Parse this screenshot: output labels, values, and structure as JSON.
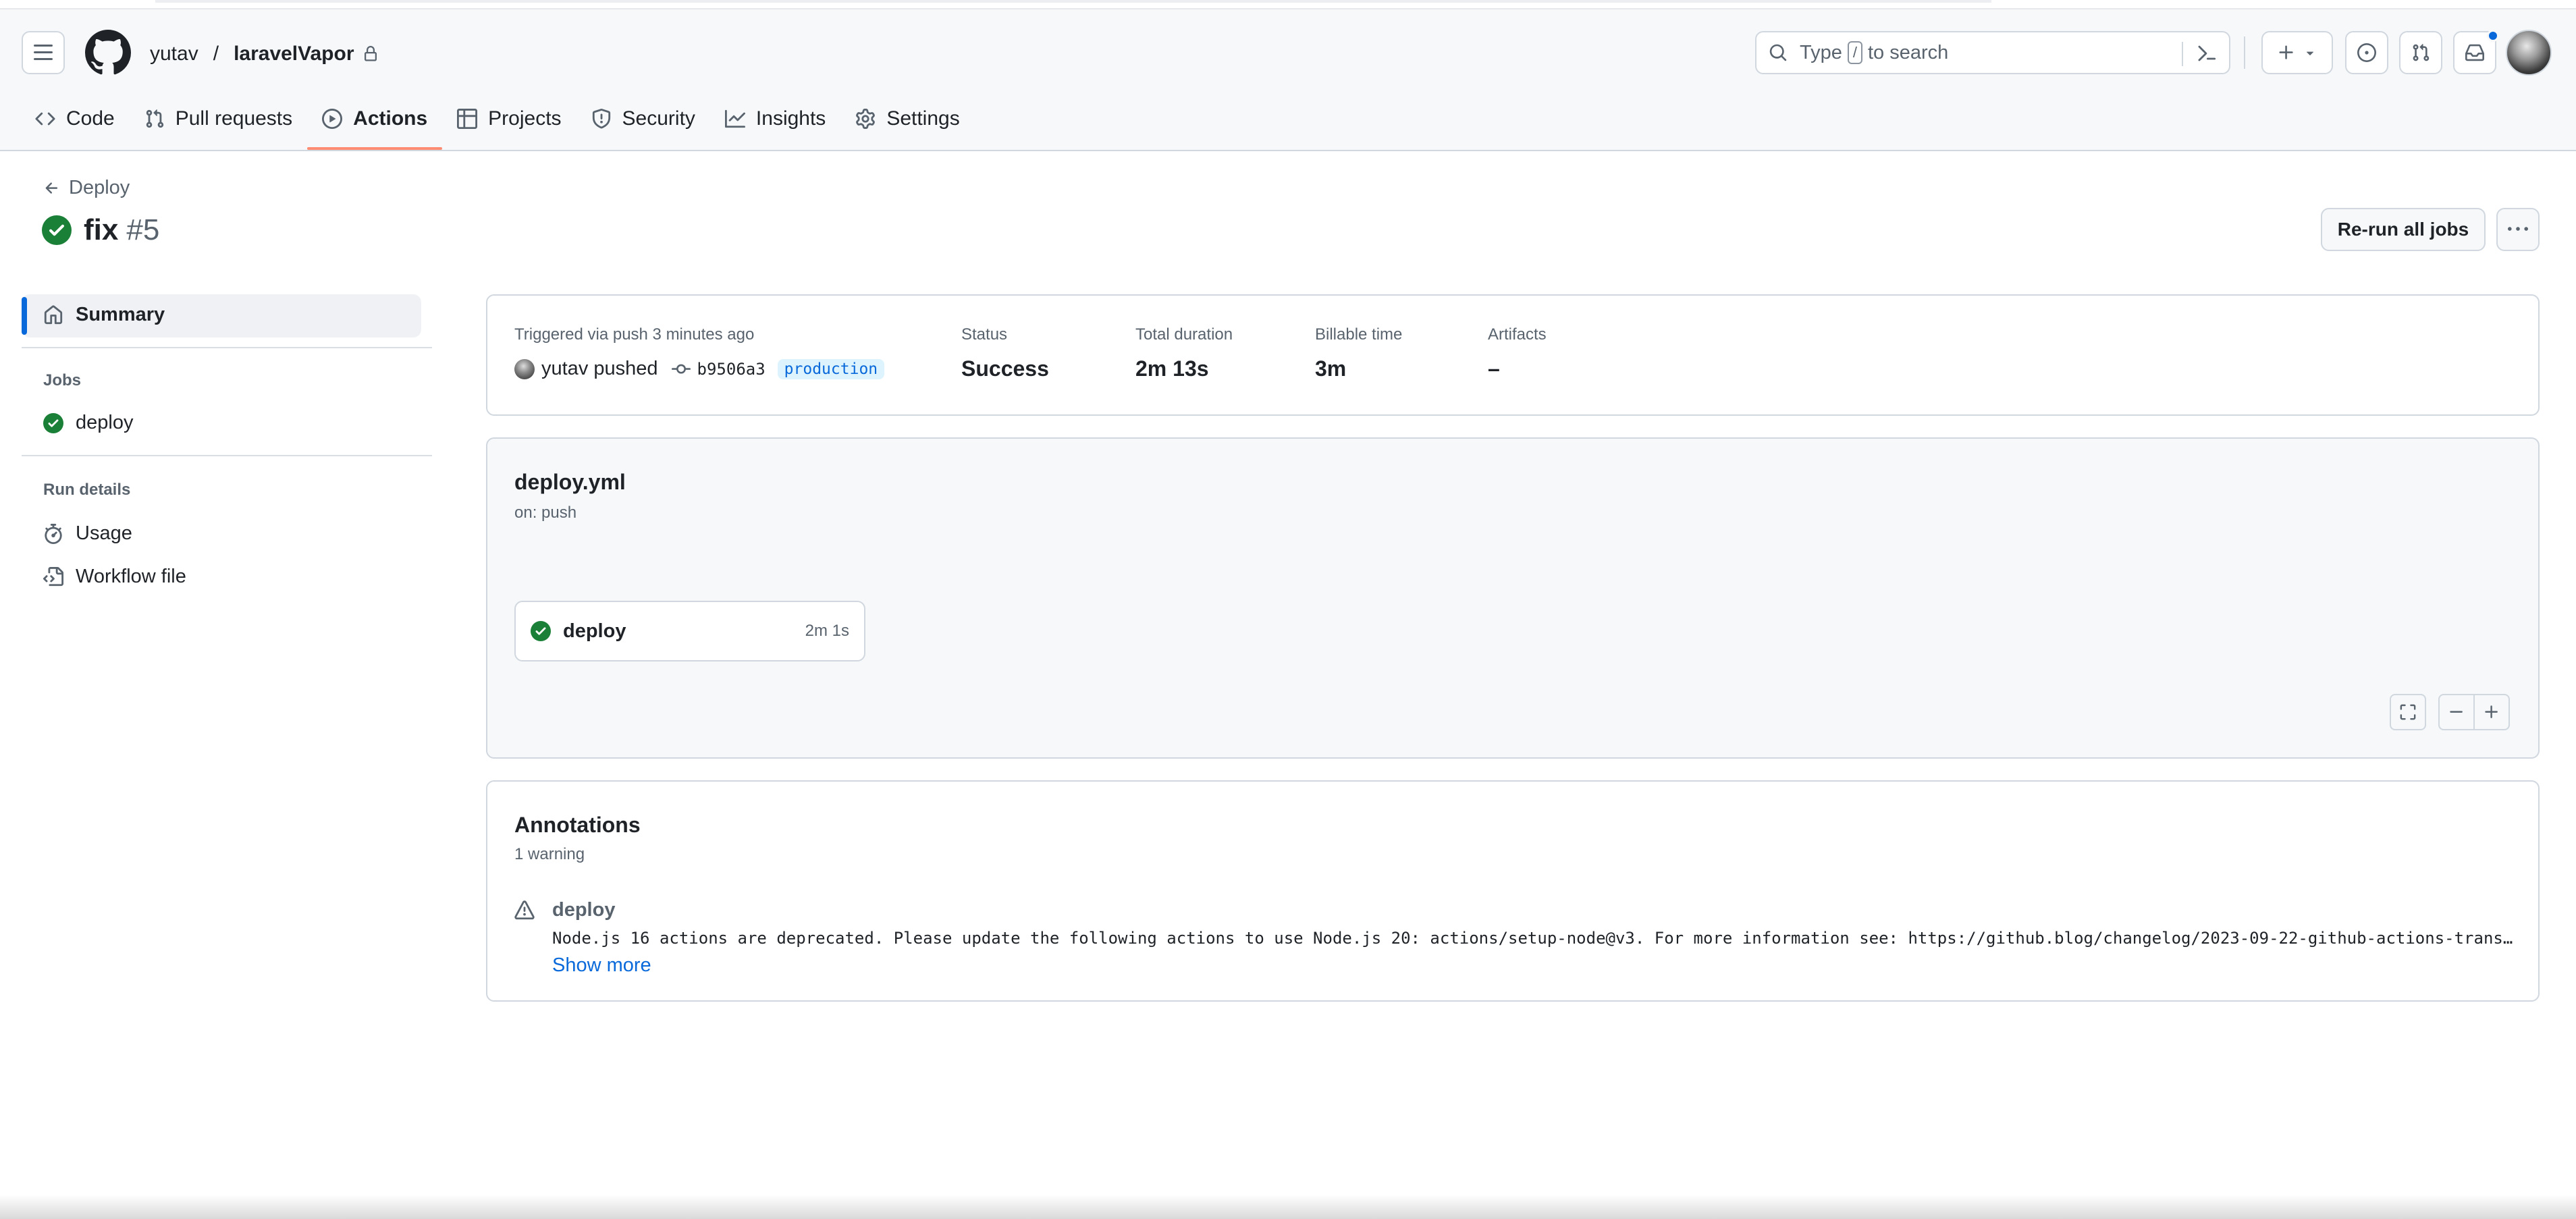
{
  "header": {
    "owner": "yutav",
    "separator": "/",
    "repo": "laravelVapor",
    "search": {
      "before": "Type",
      "key": "/",
      "after": "to search"
    }
  },
  "nav": {
    "items": [
      {
        "label": "Code",
        "icon": "code-icon"
      },
      {
        "label": "Pull requests",
        "icon": "pull-request-icon"
      },
      {
        "label": "Actions",
        "icon": "play-icon",
        "active": true
      },
      {
        "label": "Projects",
        "icon": "table-icon"
      },
      {
        "label": "Security",
        "icon": "shield-icon"
      },
      {
        "label": "Insights",
        "icon": "graph-icon"
      },
      {
        "label": "Settings",
        "icon": "gear-icon"
      }
    ]
  },
  "page": {
    "back_label": "Deploy",
    "run_title": "fix",
    "run_number": "#5",
    "rerun_label": "Re-run all jobs"
  },
  "sidebar": {
    "summary_label": "Summary",
    "jobs_heading": "Jobs",
    "job_label": "deploy",
    "run_details_heading": "Run details",
    "usage_label": "Usage",
    "workflow_file_label": "Workflow file"
  },
  "summary": {
    "trigger_text": "Triggered via push 3 minutes ago",
    "actor_text": "yutav pushed",
    "commit_sha": "b9506a3",
    "branch": "production",
    "status_label": "Status",
    "status_value": "Success",
    "duration_label": "Total duration",
    "duration_value": "2m 13s",
    "billable_label": "Billable time",
    "billable_value": "3m",
    "artifacts_label": "Artifacts",
    "artifacts_value": "–"
  },
  "workflow": {
    "file": "deploy.yml",
    "trigger": "on: push",
    "job_name": "deploy",
    "job_duration": "2m 1s"
  },
  "annotations": {
    "title": "Annotations",
    "count": "1 warning",
    "job": "deploy",
    "message": "Node.js 16 actions are deprecated. Please update the following actions to use Node.js 20: actions/setup-node@v3. For more information see: https://github.blog/changelog/2023-09-22-github-actions-trans…",
    "show_more": "Show more"
  },
  "colors": {
    "success": "#1a7f37",
    "accent": "#0969da",
    "nav_underline": "#fd8c73"
  }
}
